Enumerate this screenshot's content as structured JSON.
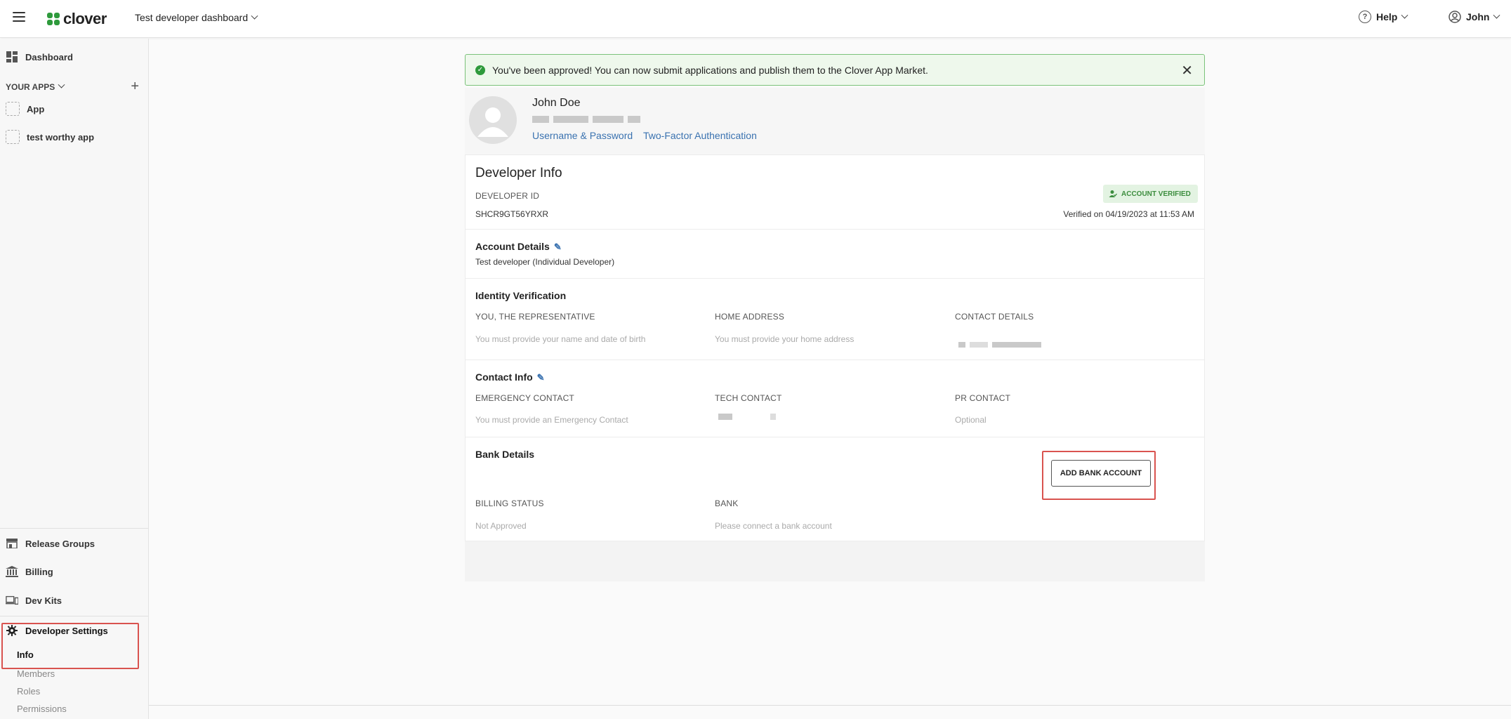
{
  "header": {
    "logo_text": "clover",
    "dashboard_select": "Test developer dashboard",
    "help_label": "Help",
    "user_label": "John"
  },
  "sidebar": {
    "dashboard": "Dashboard",
    "your_apps": "YOUR APPS",
    "apps": [
      "App",
      "test worthy app"
    ],
    "release_groups": "Release Groups",
    "billing": "Billing",
    "dev_kits": "Dev Kits",
    "developer_settings": "Developer Settings",
    "sub_items": [
      "Info",
      "Members",
      "Roles",
      "Permissions"
    ]
  },
  "alert": {
    "message": "You've been approved!  You can now submit applications and publish them to the Clover App Market."
  },
  "profile": {
    "name": "John Doe",
    "link_username": "Username & Password",
    "link_2fa": "Two-Factor Authentication"
  },
  "developer_info": {
    "title": "Developer Info",
    "id_label": "DEVELOPER ID",
    "id_value": "SHCR9GT56YRXR",
    "badge": "ACCOUNT VERIFIED",
    "verified_on": "Verified on 04/19/2023 at 11:53 AM"
  },
  "account_details": {
    "title": "Account Details",
    "value": "Test developer (Individual Developer)"
  },
  "identity": {
    "title": "Identity Verification",
    "rep_label": "YOU, THE REPRESENTATIVE",
    "rep_value": "You must provide your name and date of birth",
    "home_label": "HOME ADDRESS",
    "home_value": "You must provide your home address",
    "contact_label": "CONTACT DETAILS"
  },
  "contact_info": {
    "title": "Contact Info",
    "emergency_label": "EMERGENCY CONTACT",
    "emergency_value": "You must provide an Emergency Contact",
    "tech_label": "TECH CONTACT",
    "pr_label": "PR CONTACT",
    "pr_value": "Optional"
  },
  "bank": {
    "title": "Bank Details",
    "add_button": "ADD BANK ACCOUNT",
    "billing_label": "BILLING STATUS",
    "billing_value": "Not Approved",
    "bank_label": "BANK",
    "bank_value": "Please connect a bank account"
  },
  "colors": {
    "accent_link": "#3a72b0",
    "success": "#2e9a3c",
    "highlight": "#d9534f"
  },
  "icons": {
    "menu": "hamburger-icon",
    "logo": "clover-leaf-icon",
    "help": "help-circle-icon",
    "user": "user-circle-icon",
    "close": "close-icon",
    "check": "check-circle-icon",
    "edit": "pencil-icon",
    "verified": "user-check-icon"
  }
}
